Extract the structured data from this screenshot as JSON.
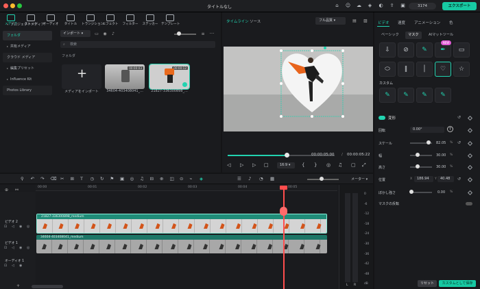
{
  "window": {
    "title": "タイトルなし",
    "credits": "3174",
    "export_label": "エクスポート",
    "traffic": [
      "#ff5f57",
      "#febc2e",
      "#28c840"
    ]
  },
  "media_tools": [
    {
      "label": "メディア",
      "icon": "media-icon"
    },
    {
      "label": "ストック",
      "icon": "stock-icon"
    },
    {
      "label": "オーディオ",
      "icon": "audio-icon"
    },
    {
      "label": "タイトル",
      "icon": "title-icon"
    },
    {
      "label": "トランジション",
      "icon": "transition-icon"
    },
    {
      "label": "エフェクト",
      "icon": "effect-icon"
    },
    {
      "label": "フィルター",
      "icon": "filter-icon"
    },
    {
      "label": "ステッカー",
      "icon": "sticker-icon"
    },
    {
      "label": "テンプレート",
      "icon": "template-icon"
    }
  ],
  "sidebar": [
    {
      "label": "プロジェクトメディア",
      "caret": "▾"
    },
    {
      "label": "フォルダ"
    },
    {
      "label": "共有メディア",
      "caret": "▸"
    },
    {
      "label": "クラウド メディア"
    },
    {
      "label": "編集プリセット",
      "caret": "▸"
    },
    {
      "label": "Influence Kit",
      "caret": "▸"
    },
    {
      "label": "Photos Library"
    }
  ],
  "media": {
    "import_label": "インポート",
    "search_placeholder": "検索",
    "folder_label": "フォルダ",
    "import_media_label": "メディアをインポート",
    "clips": [
      {
        "name": "34604-403408041_...",
        "duration": "00:00:03"
      },
      {
        "name": "21827-336300898_...",
        "duration": "00:00:12"
      }
    ]
  },
  "preview": {
    "tabs": [
      "タイムライン",
      "ソース"
    ],
    "quality": "フル品質",
    "current": "00:00:05:00",
    "sep": "/",
    "total": "00:00:05:22",
    "ratio": "16:9",
    "progress": 0.5
  },
  "right": {
    "tabs": [
      "ビデオ",
      "速度",
      "アニメーション",
      "色"
    ],
    "subtabs": [
      "ベーシック",
      "マスク",
      "AIマットツール"
    ],
    "new_badge": "NEW",
    "custom_label": "カスタム",
    "transform_label": "変形",
    "props": {
      "rotation_label": "回転",
      "rotation_value": "0.00°",
      "scale_label": "スケール",
      "scale_value": "82.05",
      "width_label": "幅",
      "width_value": "30.00",
      "height_label": "高さ",
      "height_value": "30.00",
      "position_label": "位置",
      "pos_x": "186.94",
      "pos_y": "40.48",
      "blur_label": "ぼかし強さ",
      "blur_value": "0.00",
      "invert_label": "マスクの反転",
      "unit_pct": "%",
      "unit_x": "X",
      "unit_y": "Y",
      "scale_level": 0.82,
      "width_level": 0.3,
      "height_level": 0.3,
      "blur_level": 0.0
    },
    "reset_label": "リセット",
    "save_label": "カスタムとして保存"
  },
  "timeline": {
    "meter_label": "メーター",
    "ruler": [
      "00:00",
      "00:01",
      "00:02",
      "00:03",
      "00:04",
      "00:05"
    ],
    "tracks": [
      {
        "name": "ビデオ 2",
        "clip": "21827-336300898_medium"
      },
      {
        "name": "ビデオ 1",
        "clip": "34604-403408041_medium"
      },
      {
        "name": "オーディオ 1"
      }
    ],
    "meter_ticks": [
      "0",
      "-6",
      "-12",
      "-18",
      "-24",
      "-30",
      "-36",
      "-42",
      "-48",
      "dB"
    ],
    "meter_l": "L",
    "meter_r": "R"
  }
}
